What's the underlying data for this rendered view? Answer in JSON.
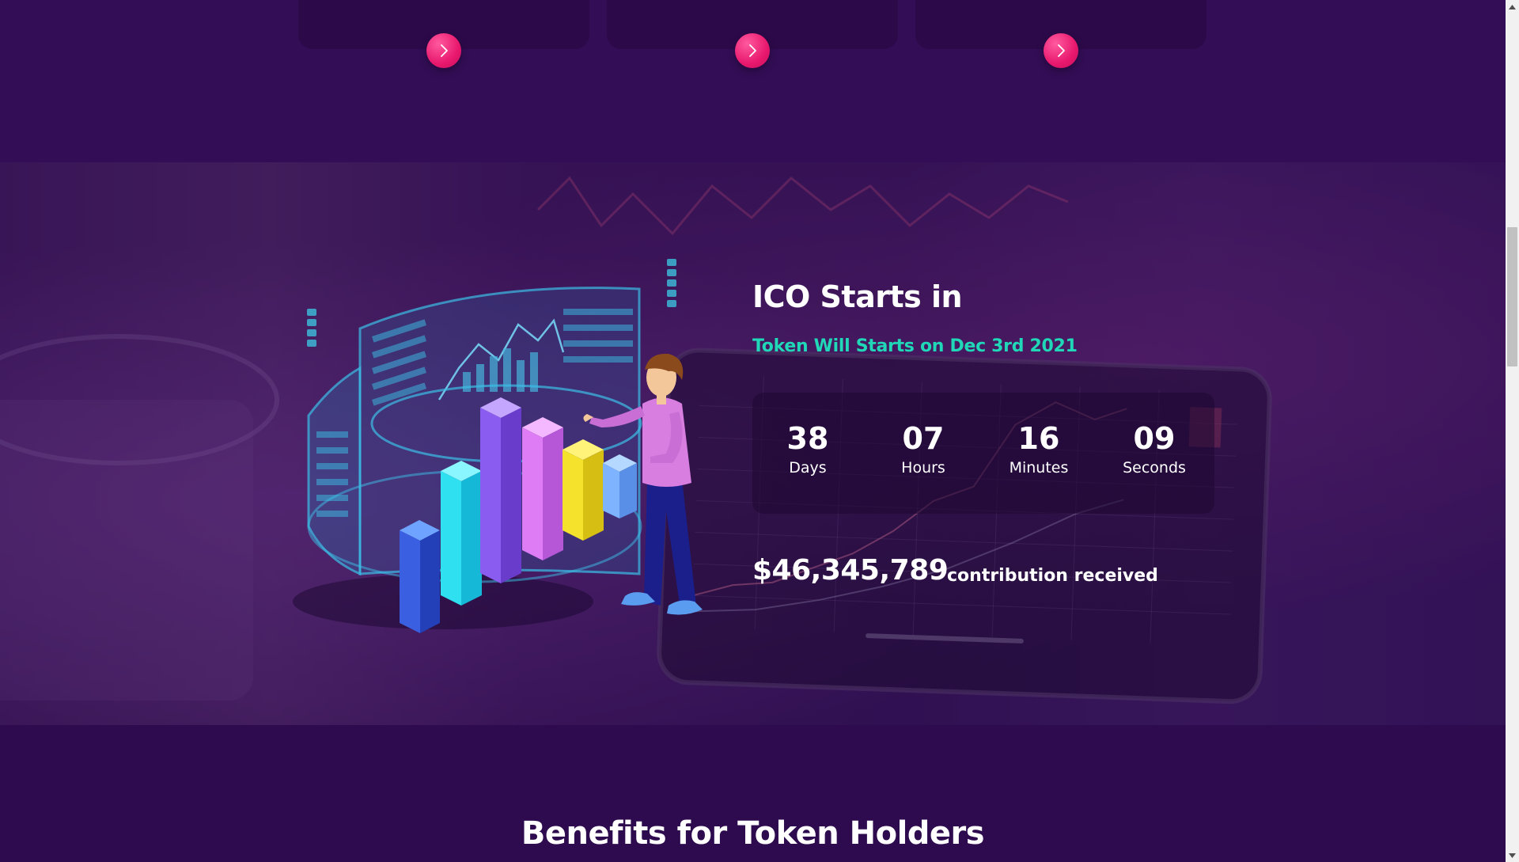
{
  "cards": {
    "buttons": [
      {
        "icon": "chevron-right-icon"
      },
      {
        "icon": "chevron-right-icon"
      },
      {
        "icon": "chevron-right-icon"
      }
    ]
  },
  "ico": {
    "title": "ICO Starts in",
    "subtitle": "Token Will Starts on Dec 3rd 2021",
    "countdown": {
      "days_value": "38",
      "days_label": "Days",
      "hours_value": "07",
      "hours_label": "Hours",
      "minutes_value": "16",
      "minutes_label": "Minutes",
      "seconds_value": "09",
      "seconds_label": "Seconds"
    },
    "amount": "$46,345,789",
    "amount_label": "contribution received",
    "illustration": "person-with-3d-bar-chart-illustration"
  },
  "benefits": {
    "title": "Benefits for Token Holders"
  },
  "colors": {
    "background": "#330d55",
    "accent_pink": "#e8186d",
    "accent_teal": "#20d8b8",
    "text": "#ffffff"
  }
}
